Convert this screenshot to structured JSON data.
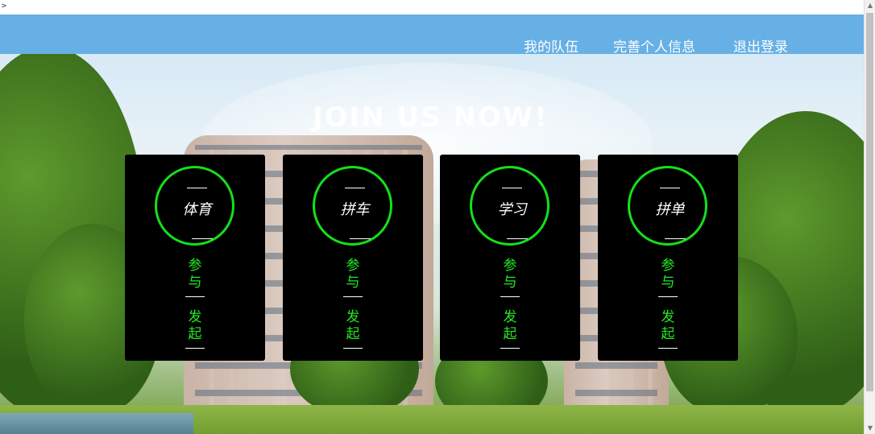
{
  "stray_text": ">",
  "nav": {
    "my_team": "我的队伍",
    "profile": "完善个人信息",
    "logout": "退出登录"
  },
  "hero": {
    "title": "JOIN US NOW!"
  },
  "cards": [
    {
      "category": "体育",
      "join": "参与",
      "start": "发起"
    },
    {
      "category": "拼车",
      "join": "参与",
      "start": "发起"
    },
    {
      "category": "学习",
      "join": "参与",
      "start": "发起"
    },
    {
      "category": "拼单",
      "join": "参与",
      "start": "发起"
    }
  ],
  "colors": {
    "navbar": "#66b0e5",
    "accent_green": "#14e01a",
    "card_bg": "#000000"
  },
  "icons": {
    "scroll_up": "scroll-up-arrow-icon",
    "scroll_down": "scroll-down-arrow-icon"
  }
}
